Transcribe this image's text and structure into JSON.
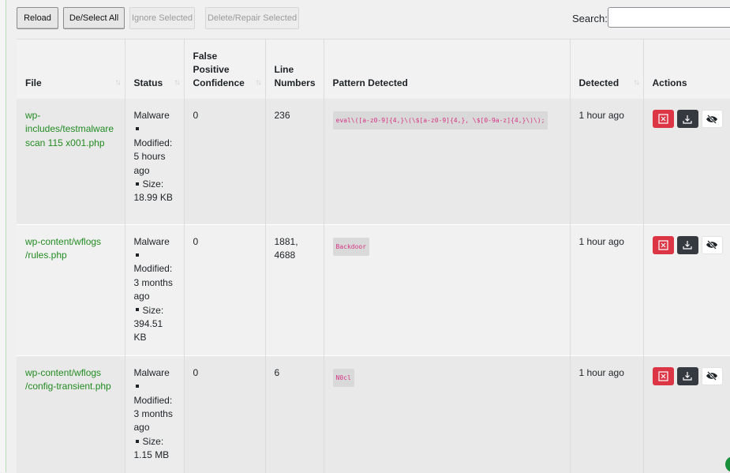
{
  "toolbar": {
    "reload": "Reload",
    "deselect_all": "De/Select All",
    "ignore_selected": "Ignore Selected",
    "delete_repair_selected": "Delete/Repair Selected"
  },
  "search": {
    "label": "Search:",
    "value": ""
  },
  "table": {
    "headers": {
      "file": "File",
      "status": "Status",
      "false_positive_confidence": [
        "False",
        "Positive",
        "Confidence"
      ],
      "line_numbers": [
        "Line",
        "Numbers"
      ],
      "pattern_detected": "Pattern Detected",
      "detected": "Detected",
      "actions": "Actions"
    },
    "rows": [
      {
        "file_lines": [
          "wp-",
          "includes/testmalware",
          "scan 115 x001.php"
        ],
        "status": "Malware",
        "modified_label": "Modified:",
        "modified_lines": [
          "5 hours",
          "ago"
        ],
        "size_label": "Size:",
        "size": "18.99 KB",
        "confidence": "0",
        "line_numbers": [
          "236"
        ],
        "pattern": "eval\\([a-z0-9]{4,}\\(\\$[a-z0-9]{4,}, \\$[0-9a-z]{4,}\\)\\);",
        "detected": "1 hour ago"
      },
      {
        "file_lines": [
          "wp-content/wflogs",
          "/rules.php"
        ],
        "status": "Malware",
        "modified_label": "Modified:",
        "modified_lines": [
          "3 months",
          "ago"
        ],
        "size_label": "Size:",
        "size": "394.51 KB",
        "confidence": "0",
        "line_numbers": [
          "1881,",
          "4688"
        ],
        "pattern": "Backdoor",
        "detected": "1 hour ago"
      },
      {
        "file_lines": [
          "wp-content/wflogs",
          "/config-transient.php"
        ],
        "status": "Malware",
        "modified_label": "Modified:",
        "modified_lines": [
          "3 months",
          "ago"
        ],
        "size_label": "Size:",
        "size": "1.15 MB",
        "confidence": "0",
        "line_numbers": [
          "6"
        ],
        "pattern": "N0cl",
        "detected": "1 hour ago"
      }
    ]
  },
  "icons": {
    "delete": "close-square-icon",
    "download": "download-icon",
    "ignore": "eye-slash-icon",
    "sort": "sort-arrows-icon"
  },
  "colors": {
    "file_link": "#228b22",
    "delete_button": "#dc3545",
    "download_button": "#343a40",
    "pattern_text": "#d63384"
  }
}
